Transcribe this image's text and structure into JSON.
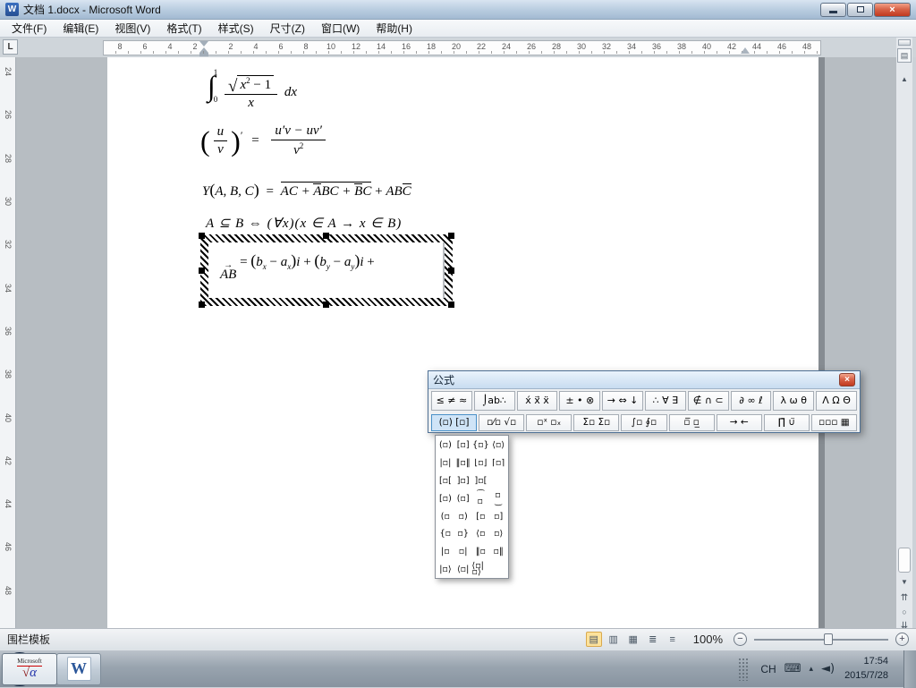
{
  "window": {
    "title": "文档 1.docx - Microsoft Word",
    "app_initial": "W"
  },
  "menu": {
    "items": [
      "文件(F)",
      "编辑(E)",
      "视图(V)",
      "格式(T)",
      "样式(S)",
      "尺寸(Z)",
      "窗口(W)",
      "帮助(H)"
    ]
  },
  "ruler_h": {
    "left_numbers": [
      "8",
      "6",
      "4",
      "2"
    ],
    "right_numbers": [
      "2",
      "4",
      "6",
      "8",
      "10",
      "12",
      "14",
      "16",
      "18",
      "20",
      "22",
      "24",
      "26",
      "28",
      "30",
      "32",
      "34",
      "36",
      "38",
      "40",
      "42",
      "44",
      "46",
      "48"
    ]
  },
  "ruler_v": {
    "numbers": [
      "24",
      "26",
      "28",
      "30",
      "32",
      "34",
      "36",
      "38",
      "40",
      "42",
      "44",
      "46",
      "48"
    ]
  },
  "equations": {
    "eq1": {
      "integral": "∫",
      "upper": "1",
      "lower": "0",
      "sqrt": "√",
      "num_base": "x",
      "num_exp": "2",
      "num_tail": " − 1",
      "den": "x",
      "trail": "dx"
    },
    "eq2": {
      "lp": "(",
      "u": "u",
      "v": "v",
      "rp": ")",
      "prime": "′",
      "equals": "=",
      "num": "u′v − uv′",
      "den_base": "v",
      "den_exp": "2"
    },
    "eq3": {
      "lhs": "Y",
      "open": "(",
      "args": "A, B, C",
      "close": ")",
      "equals": "= ",
      "t1": "AC + ",
      "abar": "A",
      "t2": "BC + ",
      "bbar": "B",
      "t3": "C",
      "plus": " + ",
      "ab": "AB",
      "cbar": "C"
    },
    "eq4": {
      "text": "A ⊆ B ⇔ (∀x)(x ∈ A → x ∈ B)"
    },
    "eq5": {
      "vec_base": "AB",
      "vec_arrow": "→",
      "equals": " = ",
      "lp": "(",
      "b1": "b",
      "s1": "x",
      "minus1": " − ",
      "a1": "a",
      "s2": "x",
      "rp": ")",
      "i1": "i",
      "plus1": " + ",
      "lp2": "(",
      "b2": "b",
      "s3": "y",
      "minus2": " − ",
      "a2": "a",
      "s4": "y",
      "rp2": ")",
      "i2": "i",
      "plus2": " +"
    }
  },
  "palette": {
    "title": "公式",
    "row1": [
      "≤ ≠ ≈",
      "⌡ab∴",
      "x́ x⃗ ẍ",
      "± • ⊗",
      "→ ⇔ ↓",
      "∴ ∀ ∃",
      "∉ ∩ ⊂",
      "∂ ∞ ℓ",
      "λ ω θ",
      "Λ Ω Θ"
    ],
    "row2": [
      "(▫) [▫]",
      "▫⁄▫ √▫",
      "▫ˣ ▫ₓ",
      "Σ▫ Σ▫",
      "∫▫ ∮▫",
      "▫̅ ▫̲",
      "→ ←",
      "∏̈ ∪̈",
      "▫▫▫ ▦"
    ],
    "dropdown": [
      "(▫)",
      "[▫]",
      "{▫}",
      "⟨▫⟩",
      "|▫|",
      "‖▫‖",
      "⌊▫⌋",
      "⌈▫⌉",
      "[▫[",
      "]▫]",
      "]▫[",
      "",
      "[▫)",
      "(▫]",
      "⁀\n▫",
      "▫\n‿",
      "(▫",
      "▫)",
      "[▫",
      "▫]",
      "{▫",
      "▫}",
      "⟨▫",
      "▫⟩",
      "|▫",
      "▫|",
      "‖▫",
      "▫‖",
      "|▫⟩",
      "⟨▫|",
      "⟨▫|▫⟩",
      ""
    ]
  },
  "status": {
    "message": "围栏模板",
    "zoom_label": "100%",
    "view_icons": [
      "▤",
      "▥",
      "▦",
      "≣",
      "≡"
    ]
  },
  "taskbar": {
    "word_initial": "W",
    "eq_line1": "Microsoft",
    "eq_sqrt": "√",
    "eq_alpha": "α",
    "lang": "CH",
    "time": "17:54",
    "date": "2015/7/28"
  },
  "icons": {
    "close": "×",
    "tab_stop": "L",
    "ruler_toggle": "▤",
    "scroll_up": "▲",
    "scroll_down": "▼",
    "prev_page": "⇈",
    "browse_object": "○",
    "next_page": "⇊",
    "zoom_minus": "−",
    "zoom_plus": "+",
    "tray_hidden": "▴",
    "keyboard": "⌨",
    "speaker": "◄)"
  },
  "colors": {
    "close_button": "#c0391f",
    "active_view_highlight": "#fde29b",
    "word_blue": "#2b579a"
  }
}
